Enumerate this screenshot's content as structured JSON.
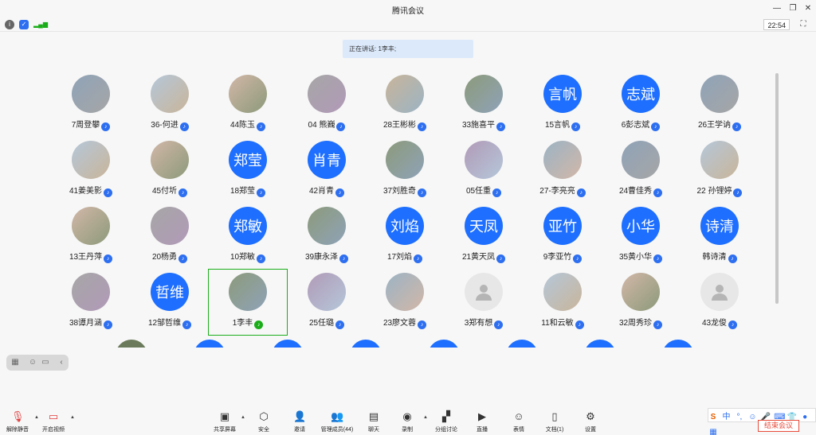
{
  "window": {
    "title": "腾讯会议"
  },
  "infobar": {
    "clock": "22:54"
  },
  "speaking": {
    "text": "正在讲话: 1李丰;"
  },
  "participants": [
    {
      "name": "7周登攀",
      "avatar": "photo",
      "mic": "mic"
    },
    {
      "name": "36-何进",
      "avatar": "photo",
      "mic": "mic"
    },
    {
      "name": "44陈玉",
      "avatar": "photo",
      "mic": "mic"
    },
    {
      "name": "04 熊巍",
      "avatar": "photo",
      "mic": "mic"
    },
    {
      "name": "28王彬彬",
      "avatar": "photo",
      "mic": "mic"
    },
    {
      "name": "33施喜平",
      "avatar": "photo",
      "mic": "mic"
    },
    {
      "name": "15言帆",
      "avatar": "text",
      "initials": "言帆",
      "mic": "mic"
    },
    {
      "name": "6彭志斌",
      "avatar": "text",
      "initials": "志斌",
      "mic": "mic"
    },
    {
      "name": "26王学讷",
      "avatar": "photo",
      "mic": "mic"
    },
    {
      "name": "41姜美影",
      "avatar": "photo",
      "mic": "mic"
    },
    {
      "name": "45付圻",
      "avatar": "photo",
      "mic": "mic"
    },
    {
      "name": "18郑莹",
      "avatar": "text",
      "initials": "郑莹",
      "mic": "mic"
    },
    {
      "name": "42肖青",
      "avatar": "text",
      "initials": "肖青",
      "mic": "mic"
    },
    {
      "name": "37刘胜奇",
      "avatar": "photo",
      "mic": "mic"
    },
    {
      "name": "05任重",
      "avatar": "photo",
      "mic": "mic"
    },
    {
      "name": "27-李亮亮",
      "avatar": "photo",
      "mic": "mic"
    },
    {
      "name": "24曹佳秀",
      "avatar": "photo",
      "mic": "mic"
    },
    {
      "name": "22 孙锂婷",
      "avatar": "photo",
      "mic": "mic"
    },
    {
      "name": "13王丹萍",
      "avatar": "photo",
      "mic": "mic"
    },
    {
      "name": "20杨勇",
      "avatar": "photo",
      "mic": "mic"
    },
    {
      "name": "10郑敏",
      "avatar": "text",
      "initials": "郑敏",
      "mic": "mic"
    },
    {
      "name": "39康永泽",
      "avatar": "photo",
      "mic": "mic"
    },
    {
      "name": "17刘焰",
      "avatar": "text",
      "initials": "刘焰",
      "mic": "mic"
    },
    {
      "name": "21黄天凤",
      "avatar": "text",
      "initials": "天凤",
      "mic": "mic"
    },
    {
      "name": "9李亚竹",
      "avatar": "text",
      "initials": "亚竹",
      "mic": "mic"
    },
    {
      "name": "35黄小华",
      "avatar": "text",
      "initials": "小华",
      "mic": "mic"
    },
    {
      "name": "韩诗清",
      "avatar": "text",
      "initials": "诗清",
      "mic": "mic"
    },
    {
      "name": "38谭月涵",
      "avatar": "photo",
      "mic": "mic"
    },
    {
      "name": "12邹哲维",
      "avatar": "text",
      "initials": "哲维",
      "mic": "mic"
    },
    {
      "name": "1李丰",
      "avatar": "photo",
      "mic": "speaking",
      "active": true
    },
    {
      "name": "25任璐",
      "avatar": "photo",
      "mic": "mic"
    },
    {
      "name": "23廖文蓉",
      "avatar": "photo",
      "mic": "mic"
    },
    {
      "name": "3郑有想",
      "avatar": "placeholder",
      "mic": "mic"
    },
    {
      "name": "11和云敏",
      "avatar": "photo",
      "mic": "mic"
    },
    {
      "name": "32周秀珍",
      "avatar": "photo",
      "mic": "mic"
    },
    {
      "name": "43龙俊",
      "avatar": "placeholder",
      "mic": "mic"
    }
  ],
  "toolbar": {
    "left": [
      {
        "label": "解除静音",
        "icon": "mic-muted-icon"
      },
      {
        "label": "开启视频",
        "icon": "video-off-icon"
      }
    ],
    "center": [
      {
        "label": "共享屏幕",
        "icon": "share-screen-icon"
      },
      {
        "label": "安全",
        "icon": "shield-icon"
      },
      {
        "label": "邀请",
        "icon": "invite-icon"
      },
      {
        "label": "管理成员(44)",
        "icon": "members-icon"
      },
      {
        "label": "聊天",
        "icon": "chat-icon"
      },
      {
        "label": "录制",
        "icon": "record-icon"
      },
      {
        "label": "分组讨论",
        "icon": "breakout-icon"
      },
      {
        "label": "直播",
        "icon": "live-icon"
      },
      {
        "label": "表情",
        "icon": "emoji-icon"
      },
      {
        "label": "文档(1)",
        "icon": "document-icon"
      },
      {
        "label": "设置",
        "icon": "gear-icon"
      }
    ],
    "end_meeting": "结束会议"
  },
  "ime": {
    "mode": "中"
  },
  "colors": {
    "accent": "#1e6fff",
    "active_border": "#1aad19",
    "end": "#e74c3c"
  }
}
